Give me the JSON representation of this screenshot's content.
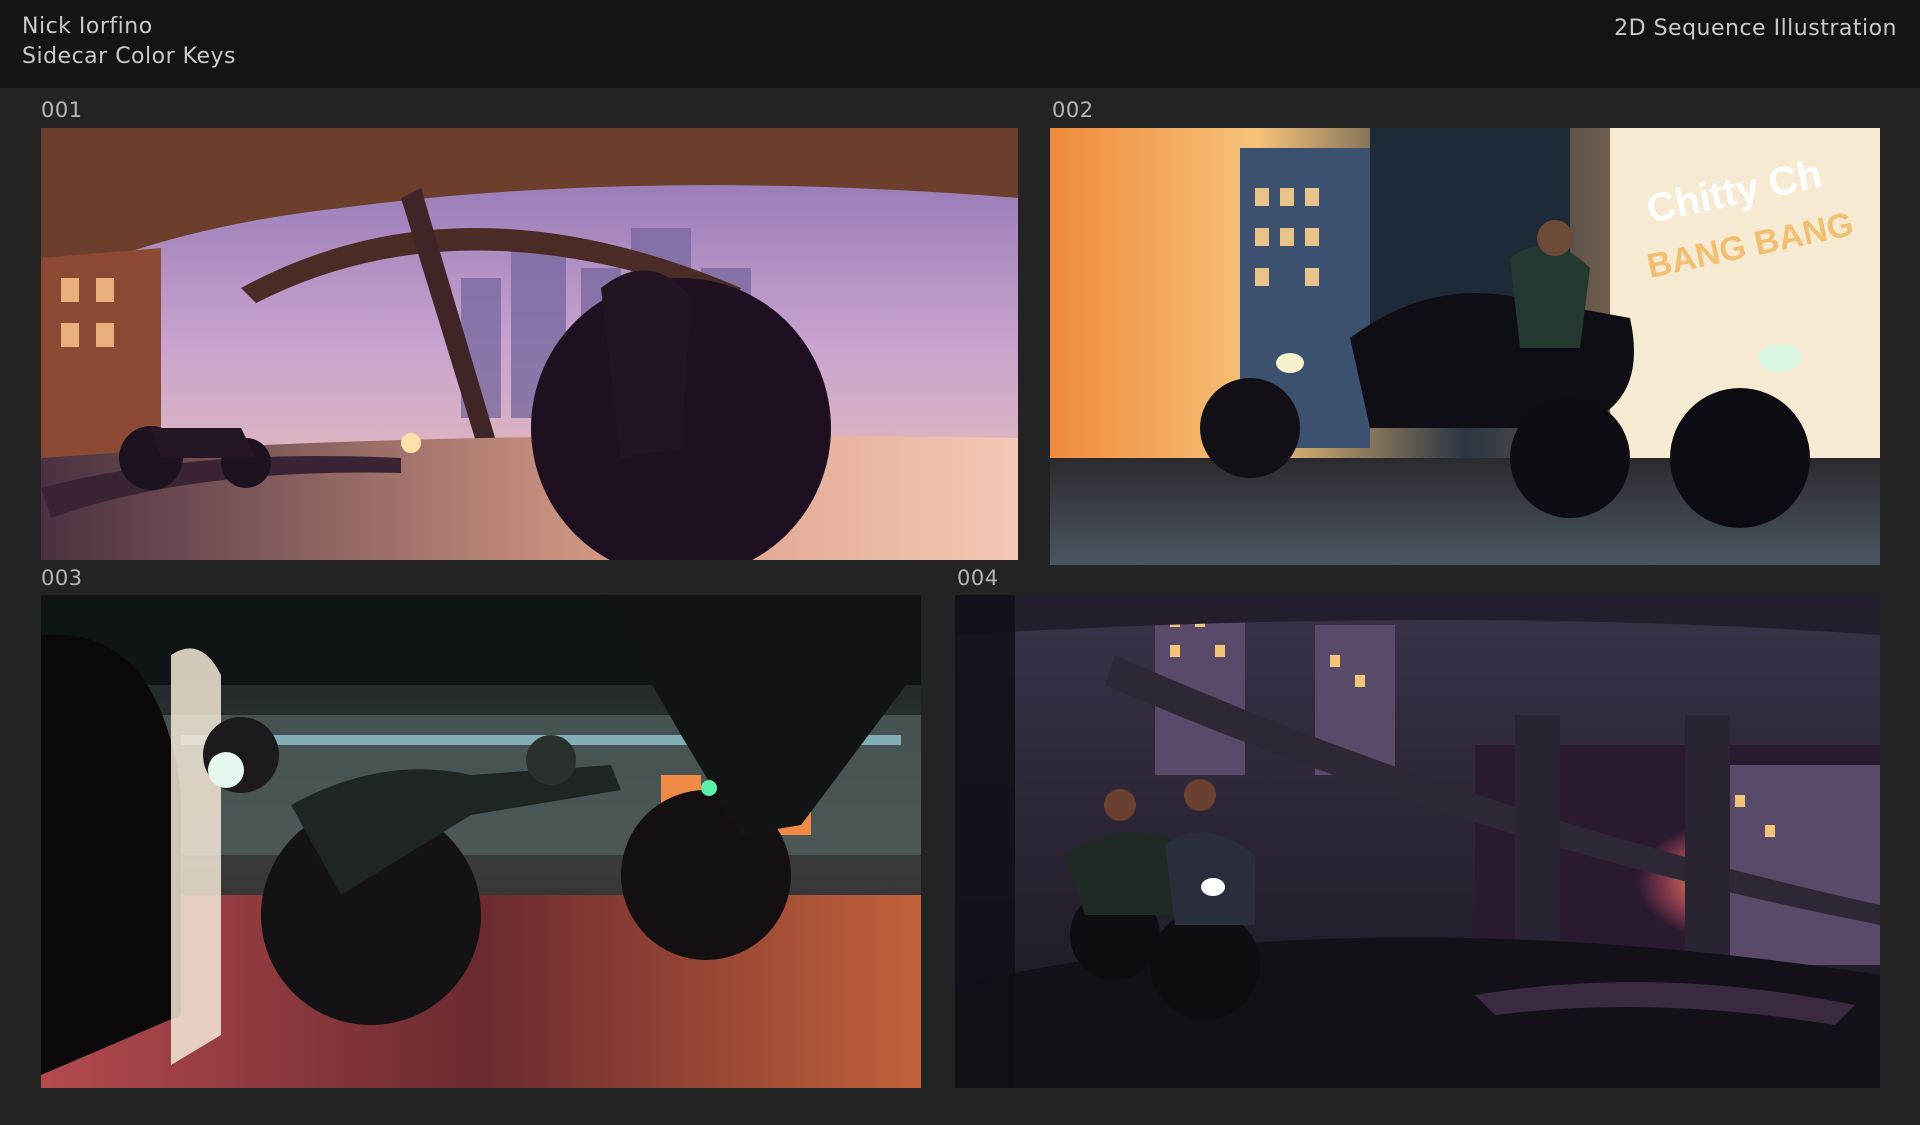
{
  "header": {
    "artist": "Nick Iorfino",
    "project": "Sidecar Color Keys",
    "category": "2D Sequence Illustration"
  },
  "panels": [
    {
      "number": "001"
    },
    {
      "number": "002"
    },
    {
      "number": "003"
    },
    {
      "number": "004"
    }
  ],
  "panel_text": {
    "sign_line_1": "Chitty Ch",
    "sign_line_2": "BANG BANG"
  }
}
